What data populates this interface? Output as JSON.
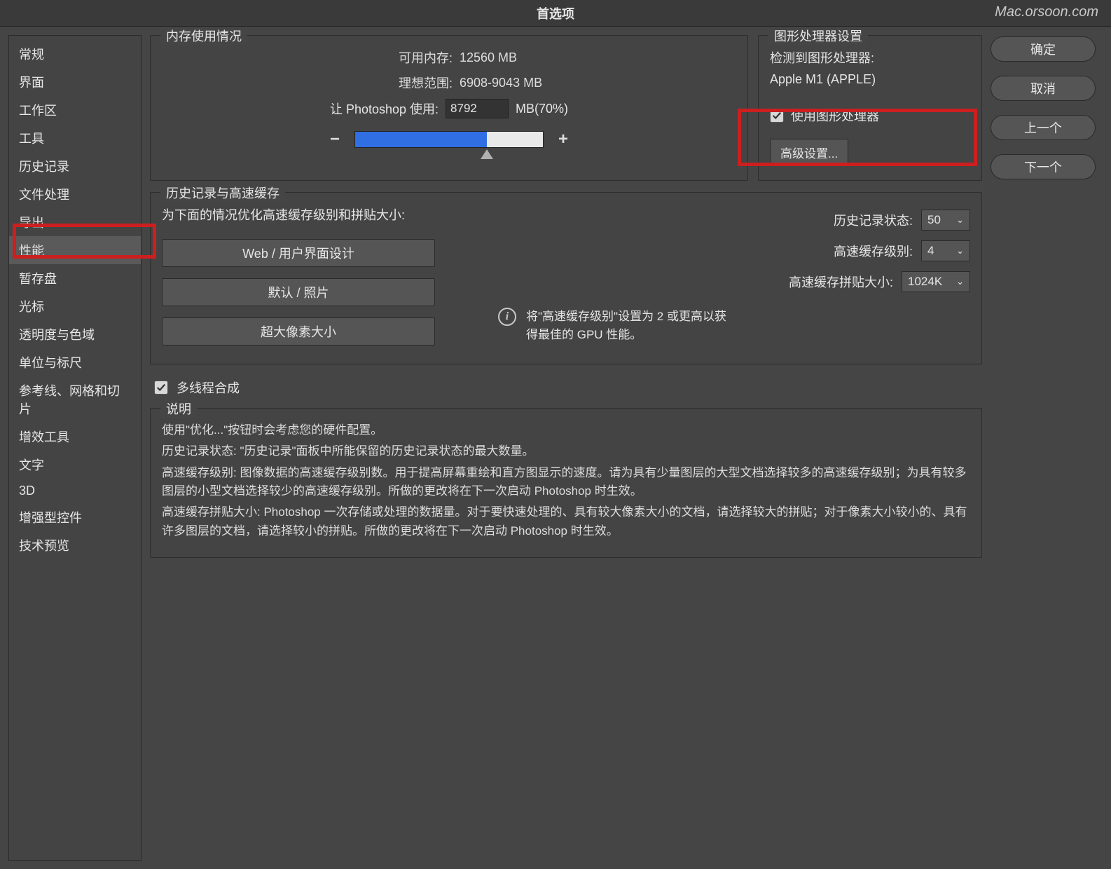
{
  "title": "首选项",
  "watermark": "Mac.orsoon.com",
  "sidebar": {
    "items": [
      "常规",
      "界面",
      "工作区",
      "工具",
      "历史记录",
      "文件处理",
      "导出",
      "性能",
      "暂存盘",
      "光标",
      "透明度与色域",
      "单位与标尺",
      "参考线、网格和切片",
      "增效工具",
      "文字",
      "3D",
      "增强型控件",
      "技术预览"
    ],
    "selected": 7
  },
  "memory": {
    "legend": "内存使用情况",
    "available_label": "可用内存:",
    "available_value": "12560 MB",
    "ideal_label": "理想范围:",
    "ideal_value": "6908-9043 MB",
    "let_label": "让 Photoshop 使用:",
    "let_value": "8792",
    "unit": "MB(70%)",
    "percent": 70
  },
  "gpu": {
    "legend": "图形处理器设置",
    "detect_label": "检测到图形处理器:",
    "detect_value": "Apple M1 (APPLE)",
    "use_gpu_label": "使用图形处理器",
    "use_gpu_checked": true,
    "advanced": "高级设置..."
  },
  "history": {
    "legend": "历史记录与高速缓存",
    "optimize_label": "为下面的情况优化高速缓存级别和拼贴大小:",
    "btn_web": "Web / 用户界面设计",
    "btn_default": "默认 / 照片",
    "btn_huge": "超大像素大小",
    "states_label": "历史记录状态:",
    "states_value": "50",
    "levels_label": "高速缓存级别:",
    "levels_value": "4",
    "tile_label": "高速缓存拼贴大小:",
    "tile_value": "1024K",
    "info": "将\"高速缓存级别\"设置为 2 或更高以获得最佳的 GPU 性能。"
  },
  "multithread": {
    "checked": true,
    "label": "多线程合成"
  },
  "desc": {
    "legend": "说明",
    "p1": "使用\"优化...\"按钮时会考虑您的硬件配置。",
    "p2": "历史记录状态: \"历史记录\"面板中所能保留的历史记录状态的最大数量。",
    "p3": "高速缓存级别: 图像数据的高速缓存级别数。用于提高屏幕重绘和直方图显示的速度。请为具有少量图层的大型文档选择较多的高速缓存级别；为具有较多图层的小型文档选择较少的高速缓存级别。所做的更改将在下一次启动 Photoshop 时生效。",
    "p4": "高速缓存拼贴大小: Photoshop 一次存储或处理的数据量。对于要快速处理的、具有较大像素大小的文档，请选择较大的拼贴；对于像素大小较小的、具有许多图层的文档，请选择较小的拼贴。所做的更改将在下一次启动 Photoshop 时生效。"
  },
  "buttons": {
    "ok": "确定",
    "cancel": "取消",
    "prev": "上一个",
    "next": "下一个"
  }
}
